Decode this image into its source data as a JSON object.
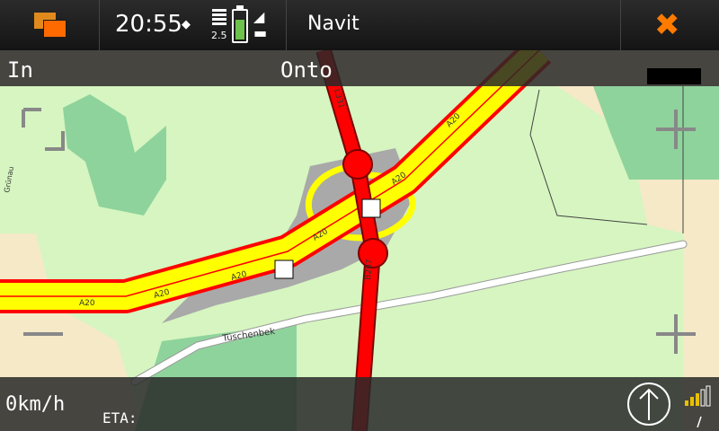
{
  "status_bar": {
    "time": "20:55",
    "signal_label": "2.5",
    "app_title": "Navit"
  },
  "instructions": {
    "in_label": "In",
    "onto_label": "Onto"
  },
  "footer": {
    "speed": "0km/h",
    "eta": "ETA:"
  },
  "map_labels": {
    "highway_a": "A20",
    "road_l": "L331",
    "road_b": "B207",
    "street": "Tüschenbek",
    "side_street": "Grünau"
  },
  "icons": {
    "app_switch": "app-switcher-icon",
    "close": "close-icon",
    "compass": "compass-north-icon",
    "gps": "gps-signal-icon"
  },
  "colors": {
    "accent": "#ff7b00",
    "highway_fill": "#ffff00",
    "highway_casing": "#ff0000",
    "primary_road": "#ff0000",
    "green_area": "#c9efb0",
    "forest": "#8fd39c",
    "sand": "#f5e9c8"
  }
}
